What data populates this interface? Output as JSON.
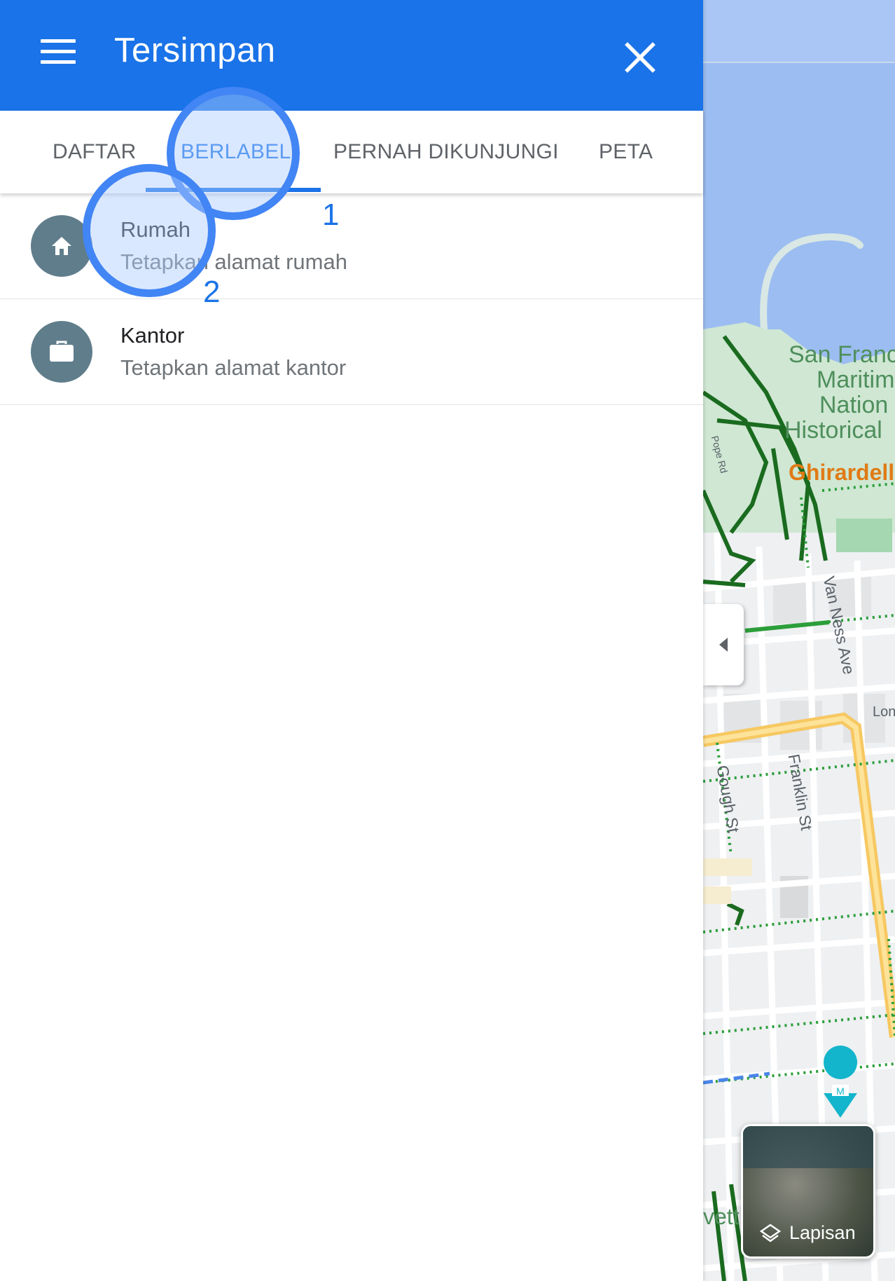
{
  "app_bar": {
    "title": "Tersimpan",
    "background_color": "#1a73e8",
    "menu_icon": "hamburger-menu-icon",
    "close_icon": "close-icon"
  },
  "tabs": [
    {
      "label": "DAFTAR",
      "active": false
    },
    {
      "label": "BERLABEL",
      "active": true
    },
    {
      "label": "PERNAH DIKUNJUNGI",
      "active": false
    },
    {
      "label": "PETA",
      "active": false
    }
  ],
  "labeled_places": [
    {
      "title": "Rumah",
      "subtitle": "Tetapkan alamat rumah",
      "icon": "home-icon"
    },
    {
      "title": "Kantor",
      "subtitle": "Tetapkan alamat kantor",
      "icon": "briefcase-icon"
    }
  ],
  "annotations": {
    "step1": "1",
    "step2": "2"
  },
  "map": {
    "labels": {
      "museum_line1": "San Franc",
      "museum_line2": "Maritim",
      "museum_line3": "Nation",
      "museum_line4": "Historical",
      "ghirardelli": "Ghirardell",
      "van_ness": "Van Ness Ave",
      "franklin": "Franklin St",
      "gough": "Gough St",
      "lom": "Lon",
      "pope_rd": "Pope Rd",
      "bottom_left": "vett"
    },
    "layers_button_label": "Lapisan",
    "layers_icon": "layers-icon",
    "collapse_icon": "collapse-arrow-icon",
    "museum_pin_icon": "museum-pin-icon"
  }
}
